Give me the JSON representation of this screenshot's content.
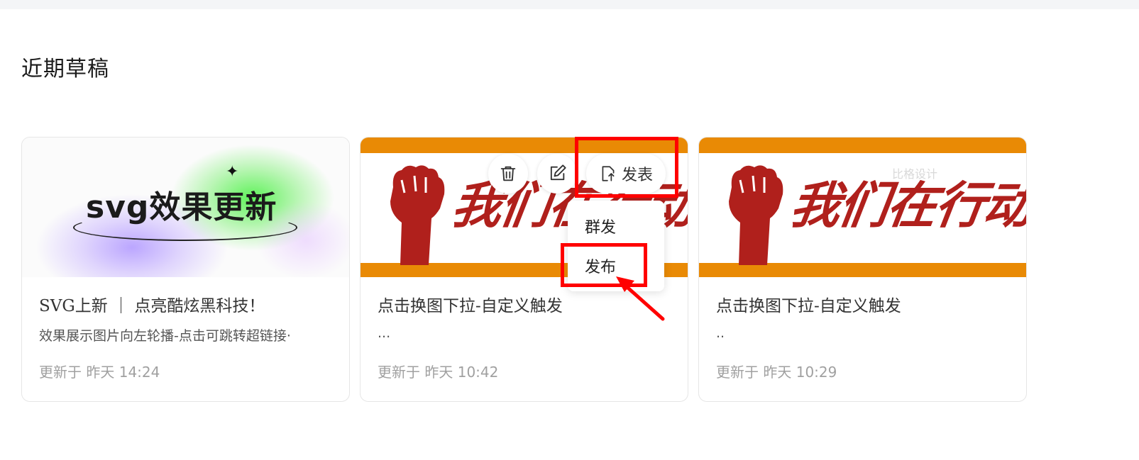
{
  "section": {
    "title": "近期草稿"
  },
  "cards": [
    {
      "cover_text": "svg效果更新",
      "title": "SVG上新 ｜ 点亮酷炫黑科技！",
      "desc": "效果展示图片向左轮播-点击可跳转超链接·",
      "meta": "更新于 昨天 14:24"
    },
    {
      "cover_text": "我们在行动",
      "title": "点击换图下拉-自定义触发",
      "desc": "...",
      "meta": "更新于 昨天 10:42"
    },
    {
      "cover_text": "我们在行动",
      "title": "点击换图下拉-自定义触发",
      "desc": "..",
      "meta": "更新于 昨天 10:29"
    }
  ],
  "actions": {
    "delete_icon": "trash-icon",
    "edit_icon": "edit-icon",
    "publish_label": "发表",
    "publish_icon": "upload-doc-icon"
  },
  "dropdown": {
    "items": [
      "群发",
      "发布"
    ]
  },
  "watermark": "比格设计",
  "colors": {
    "highlight": "#ff0000",
    "band": "#e98a05",
    "slogan": "#b0201c"
  }
}
